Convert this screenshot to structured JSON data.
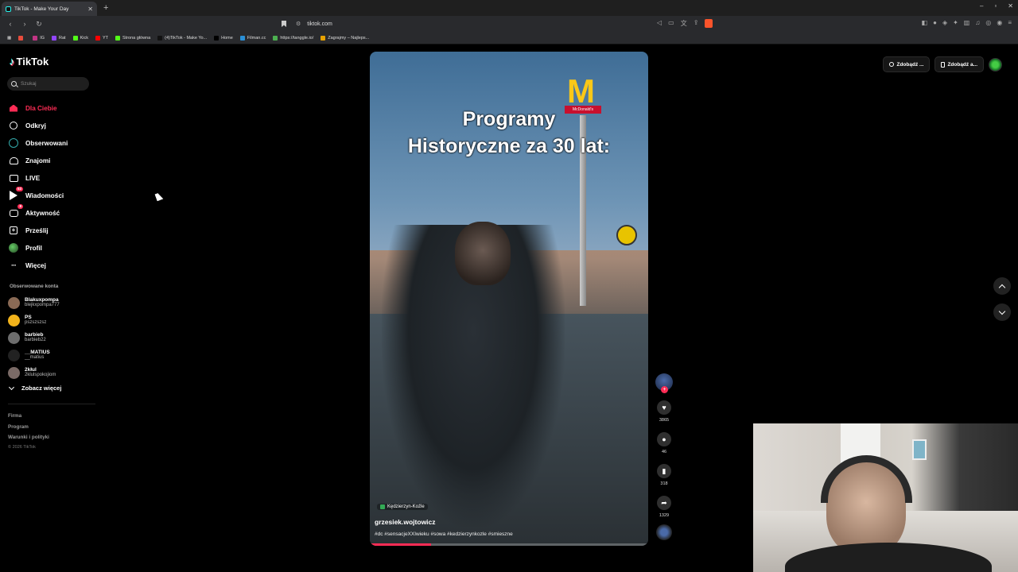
{
  "browser": {
    "tab_title": "TikTok - Make Your Day",
    "new_tab_label": "+",
    "url": "tiktok.com",
    "window_controls": [
      "–",
      "▫",
      "✕"
    ],
    "bookmarks": [
      {
        "label": "",
        "color": "#e74c3c"
      },
      {
        "label": "IG",
        "color": "#c13584"
      },
      {
        "label": "Rat",
        "color": "#9146ff"
      },
      {
        "label": "Kick",
        "color": "#53fc18"
      },
      {
        "label": "YT",
        "color": "#ff0000"
      },
      {
        "label": "Strona główna",
        "color": "#53fc18"
      },
      {
        "label": "(4)TikTok - Make Yo...",
        "color": "#111111"
      },
      {
        "label": "Home",
        "color": "#000000"
      },
      {
        "label": "Filman.cc",
        "color": "#2a8fd6"
      },
      {
        "label": "https://tanggle.io/",
        "color": "#4caf50"
      },
      {
        "label": "Zagrajmy – Najleps...",
        "color": "#e6a100"
      }
    ]
  },
  "tiktok": {
    "logo": "TikTok",
    "search_placeholder": "Szukaj",
    "nav": [
      {
        "label": "Dla Ciebie",
        "icon": "home-icon",
        "active": true,
        "badge": ""
      },
      {
        "label": "Odkryj",
        "icon": "compass-icon",
        "active": false,
        "badge": ""
      },
      {
        "label": "Obserwowani",
        "icon": "following-icon",
        "active": false,
        "badge": ""
      },
      {
        "label": "Znajomi",
        "icon": "friends-icon",
        "active": false,
        "badge": ""
      },
      {
        "label": "LIVE",
        "icon": "live-icon",
        "active": false,
        "badge": ""
      },
      {
        "label": "Wiadomości",
        "icon": "messages-icon",
        "active": false,
        "badge": "53"
      },
      {
        "label": "Aktywność",
        "icon": "activity-icon",
        "active": false,
        "badge": "8"
      },
      {
        "label": "Prześlij",
        "icon": "upload-icon",
        "active": false,
        "badge": ""
      },
      {
        "label": "Profil",
        "icon": "profile-icon",
        "active": false,
        "badge": ""
      },
      {
        "label": "Więcej",
        "icon": "more-icon",
        "active": false,
        "badge": ""
      }
    ],
    "followed_title": "Obserwowane konta",
    "followed": [
      {
        "name": "Blakuxpompa",
        "username": "blejkxpompa777",
        "color": "#8a6a55"
      },
      {
        "name": "PS",
        "username": "pszszszsz",
        "color": "#f2b31b"
      },
      {
        "name": "barbieb",
        "username": "barbieb22",
        "color": "#6d6d6d"
      },
      {
        "name": "__MATIUS",
        "username": "__matius",
        "color": "#222222"
      },
      {
        "name": "2kłul",
        "username": "2klulspokojiom",
        "color": "#7a6a66"
      }
    ],
    "see_more": "Zobacz więcej",
    "footer": {
      "links": [
        "Firma",
        "Program",
        "Warunki i polityki"
      ],
      "copyright": "© 2026 TikTok"
    },
    "top_right": {
      "btn1": "Zdobądź ...",
      "btn2": "Zdobądź a..."
    },
    "video": {
      "title_line1": "Programy",
      "title_line2": "Historyczne za 30 lat:",
      "sign_text": "McDonald's",
      "location": "Kędzierzyn-Koźle",
      "author": "grzesiek.wojtowicz",
      "hashtags": "#dc #sensacjeXXIwieku #sowa #kedzierzynkozle #smieszne",
      "progress": 0.22
    },
    "actions": {
      "likes": "3865",
      "comments": "46",
      "saves": "318",
      "shares": "1329"
    }
  }
}
